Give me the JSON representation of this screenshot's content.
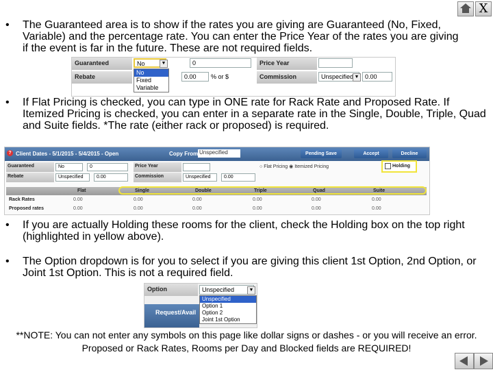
{
  "controls": {
    "close_label": "X"
  },
  "bullets": [
    "The Guaranteed area is to show if the rates you are giving are Guaranteed (No, Fixed, Variable) and the percentage rate.  You can enter the Price Year of the rates you are giving if the event is far in the future.  These are not required fields.",
    "If Flat Pricing is checked, you can type in ONE rate for Rack Rate and Proposed Rate.  If Itemized Pricing is checked, you can enter in a separate rate in the Single, Double, Triple, Quad and Suite fields.  *The rate (either rack or proposed) is required.",
    "If you are actually Holding these rooms for the client, check the Holding box on the top right (highlighted in yellow above).",
    "The Option dropdown is for you to select if you are giving this client 1st Option, 2nd Option, or Joint 1st Option.  This is not a required field."
  ],
  "shot1": {
    "guaranteed_label": "Guaranteed",
    "rebate_label": "Rebate",
    "guaranteed_value": "No",
    "options": [
      "No",
      "Fixed",
      "Variable"
    ],
    "pct_value": "0",
    "rebate_pct": "0.00",
    "pct_suffix": "% or $",
    "price_year_label": "Price Year",
    "commission_label": "Commission",
    "commission_value": "Unspecified",
    "commission_amt": "0.00"
  },
  "shot2": {
    "title": "Client Dates - 5/1/2015 - 5/4/2015 - Open",
    "copy_from_label": "Copy From",
    "copy_from_value": "Unspecified",
    "pending_save": "Pending Save",
    "accept": "Accept",
    "decline": "Decline",
    "guaranteed_label": "Guaranteed",
    "guaranteed_value": "No",
    "guaranteed_pct": "0",
    "rebate_label": "Rebate",
    "rebate_value": "Unspecified",
    "rebate_amt": "0.00",
    "price_year_label": "Price Year",
    "commission_label": "Commission",
    "commission_value": "Unspecified",
    "commission_amt": "0.00",
    "flat_pricing": "Flat Pricing",
    "itemized_pricing": "Itemized Pricing",
    "holding": "Holding",
    "columns": [
      "Flat",
      "Single",
      "Double",
      "Triple",
      "Quad",
      "Suite"
    ],
    "rows": [
      {
        "label": "Rack Rates",
        "values": [
          "0.00",
          "0.00",
          "0.00",
          "0.00",
          "0.00",
          "0.00"
        ]
      },
      {
        "label": "Proposed rates",
        "values": [
          "0.00",
          "0.00",
          "0.00",
          "0.00",
          "0.00",
          "0.00"
        ]
      }
    ]
  },
  "shot3": {
    "option_label": "Option",
    "option_value": "Unspecified",
    "options": [
      "Unspecified",
      "Option 1",
      "Option 2",
      "Joint 1st Option"
    ],
    "tab_label": "Request/Avail"
  },
  "note": "**NOTE: You can not enter any symbols on this page like dollar signs or dashes  - or you will receive an error.  Proposed or Rack Rates, Rooms per Day and Blocked fields are REQUIRED!",
  "colors": {
    "accent": "#3c6292",
    "highlight": "#f1e43a",
    "selected": "#2f62c9"
  }
}
